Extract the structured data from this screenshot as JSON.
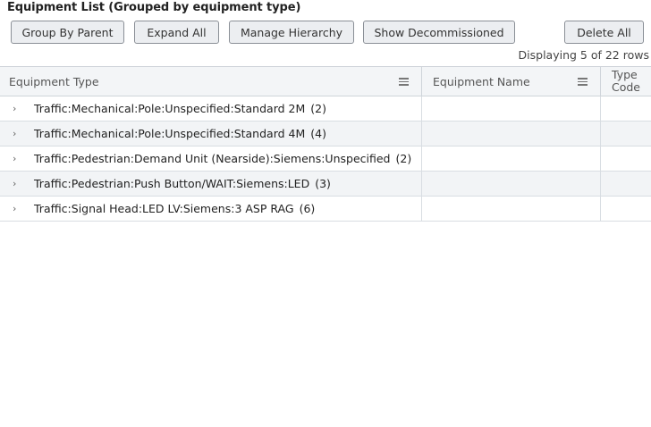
{
  "title": "Equipment List (Grouped by equipment type)",
  "toolbar": {
    "group_by_parent": "Group By Parent",
    "expand_all": "Expand All",
    "manage_hierarchy": "Manage Hierarchy",
    "show_decommissioned": "Show Decommissioned",
    "delete_all": "Delete All"
  },
  "status_text": "Displaying 5 of 22 rows",
  "columns": {
    "equipment_type": "Equipment Type",
    "equipment_name": "Equipment Name",
    "type_code": "Type Code"
  },
  "rows": [
    {
      "label": "Traffic:Mechanical:Pole:Unspecified:Standard 2M",
      "count": "(2)"
    },
    {
      "label": "Traffic:Mechanical:Pole:Unspecified:Standard 4M",
      "count": "(4)"
    },
    {
      "label": "Traffic:Pedestrian:Demand Unit (Nearside):Siemens:Unspecified",
      "count": "(2)"
    },
    {
      "label": "Traffic:Pedestrian:Push Button/WAIT:Siemens:LED",
      "count": "(3)"
    },
    {
      "label": "Traffic:Signal Head:LED LV:Siemens:3 ASP RAG",
      "count": "(6)"
    }
  ],
  "expand_icon": "chevron-right-icon"
}
